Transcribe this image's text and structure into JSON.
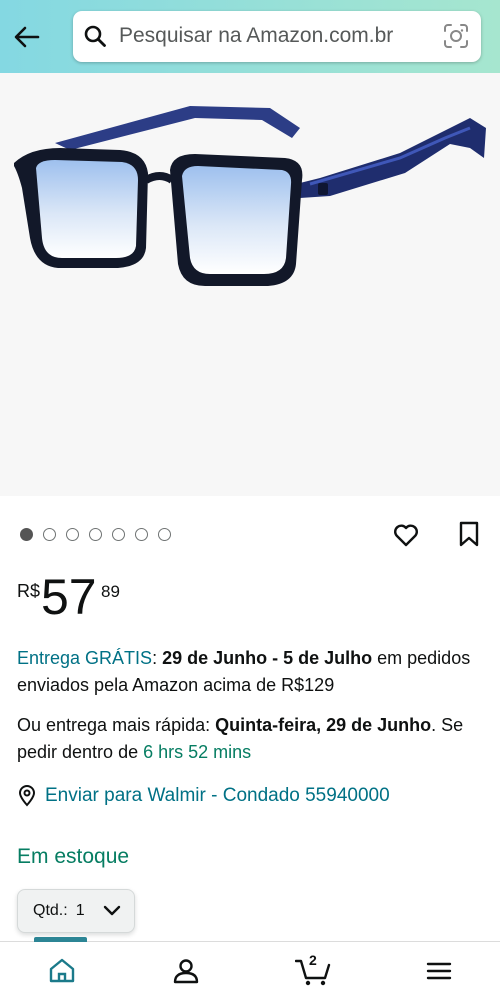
{
  "header": {
    "search_placeholder": "Pesquisar na Amazon.com.br",
    "back_icon": "arrow-left-icon",
    "camera_icon": "camera-lens-icon"
  },
  "gallery": {
    "image_count": 7,
    "active_index": 0
  },
  "price": {
    "currency": "R$",
    "whole": "57",
    "fraction": "89"
  },
  "delivery": {
    "free_label": "Entrega GRÁTIS",
    "colon": ":",
    "date_range": "29 de Junho - 5 de Julho",
    "rest": " em pedidos enviados pela Amazon acima de R$129"
  },
  "fast_delivery": {
    "prefix": "Ou entrega mais rápida: ",
    "date": "Quinta-feira, 29 de Junho",
    "middle": ". Se pedir dentro de ",
    "countdown": "6 hrs 52 mins"
  },
  "ship_to": {
    "label": "Enviar para Walmir - Condado 55940000"
  },
  "stock": {
    "label": "Em estoque"
  },
  "quantity": {
    "label": "Qtd.:",
    "value": "1"
  },
  "bottom_nav": {
    "cart_count": "2",
    "items": [
      "home-icon",
      "account-icon",
      "cart-icon",
      "menu-icon"
    ]
  },
  "colors": {
    "header_start": "#84d8e2",
    "header_end": "#a6e6cf",
    "link": "#007185",
    "in_stock": "#067d62",
    "nav_active": "#2c8595"
  }
}
